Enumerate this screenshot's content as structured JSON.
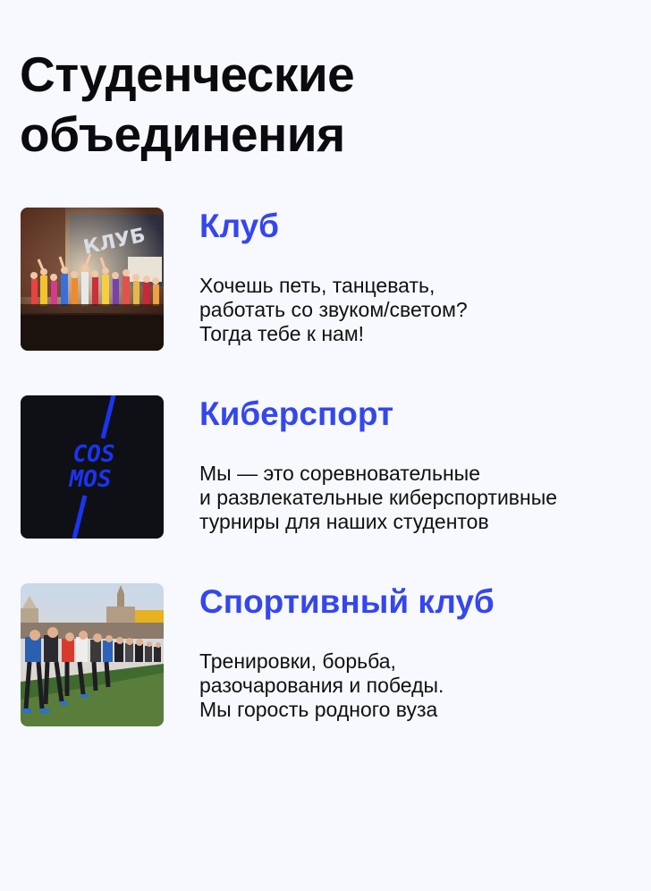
{
  "page": {
    "title_line1": "Студенческие",
    "title_line2": "объединения"
  },
  "colors": {
    "accent": "#3447ee",
    "text": "#111111",
    "background": "#f8f9fe"
  },
  "organizations": [
    {
      "title": "Клуб",
      "description": [
        "Хочешь петь, танцевать,",
        "работать со звуком/светом?",
        "Тогда тебе к нам!"
      ],
      "image": "stage-performance-photo"
    },
    {
      "title": "Киберспорт",
      "description": [
        "Мы — это соревновательные",
        "и развлекательные киберспортивные",
        "турниры для наших студентов"
      ],
      "image": "cosmos-esports-logo",
      "logo_text": [
        "COS",
        "MOS"
      ]
    },
    {
      "title": "Спортивный клуб",
      "description": [
        "Тренировки, борьба,",
        "разочарования и победы.",
        "Мы горость родного вуза"
      ],
      "image": "stadium-race-start-photo"
    }
  ]
}
